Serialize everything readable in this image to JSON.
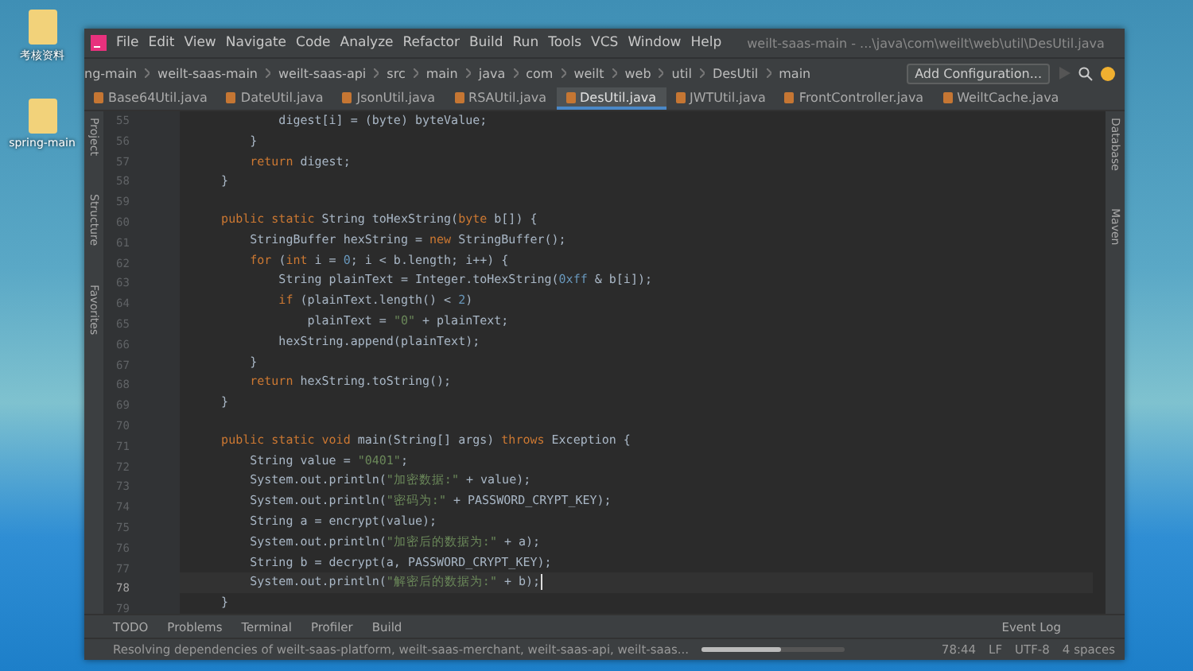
{
  "desktop_icons": [
    {
      "label": "考核资料"
    },
    {
      "label": "spring-main"
    }
  ],
  "window": {
    "title": "weilt-saas-main - ...\\java\\com\\weilt\\web\\util\\DesUtil.java"
  },
  "menu": [
    "File",
    "Edit",
    "View",
    "Navigate",
    "Code",
    "Analyze",
    "Refactor",
    "Build",
    "Run",
    "Tools",
    "VCS",
    "Window",
    "Help"
  ],
  "breadcrumbs": [
    "ng-main",
    "weilt-saas-main",
    "weilt-saas-api",
    "src",
    "main",
    "java",
    "com",
    "weilt",
    "web",
    "util",
    "DesUtil",
    "main"
  ],
  "run_config": "Add Configuration...",
  "tabs": [
    {
      "label": "Base64Util.java",
      "selected": false
    },
    {
      "label": "DateUtil.java",
      "selected": false
    },
    {
      "label": "JsonUtil.java",
      "selected": false
    },
    {
      "label": "RSAUtil.java",
      "selected": false
    },
    {
      "label": "DesUtil.java",
      "selected": true
    },
    {
      "label": "JWTUtil.java",
      "selected": false
    },
    {
      "label": "FrontController.java",
      "selected": false
    },
    {
      "label": "WeiltCache.java",
      "selected": false
    }
  ],
  "left_tools": [
    "Project",
    "Structure",
    "Favorites"
  ],
  "right_tools": [
    "Database",
    "Maven"
  ],
  "code": [
    {
      "number": "55",
      "current": false,
      "parts": [
        {
          "kind": "plain",
          "text": "            digest[i] = (byte) byteValue;"
        }
      ]
    },
    {
      "number": "56",
      "current": false,
      "parts": [
        {
          "kind": "plain",
          "text": "        }"
        }
      ]
    },
    {
      "number": "57",
      "current": false,
      "parts": [
        {
          "kind": "keyword",
          "text": "        return "
        },
        {
          "kind": "plain",
          "text": "digest;"
        }
      ]
    },
    {
      "number": "58",
      "current": false,
      "parts": [
        {
          "kind": "plain",
          "text": "    }"
        }
      ]
    },
    {
      "number": "59",
      "current": false
    },
    {
      "number": "60",
      "current": false,
      "parts": [
        {
          "kind": "keyword",
          "text": "    public static "
        },
        {
          "kind": "plain",
          "text": "String toHexString("
        },
        {
          "kind": "keyword",
          "text": "byte "
        },
        {
          "kind": "plain",
          "text": "b[]) {"
        }
      ]
    },
    {
      "number": "61",
      "current": false,
      "parts": [
        {
          "kind": "plain",
          "text": "        StringBuffer hexString = "
        },
        {
          "kind": "keyword",
          "text": "new "
        },
        {
          "kind": "plain",
          "text": "StringBuffer();"
        }
      ]
    },
    {
      "number": "62",
      "current": false,
      "parts": [
        {
          "kind": "keyword",
          "text": "        for "
        },
        {
          "kind": "plain",
          "text": "("
        },
        {
          "kind": "keyword",
          "text": "int "
        },
        {
          "kind": "plain",
          "text": "i = "
        },
        {
          "kind": "number",
          "text": "0"
        },
        {
          "kind": "plain",
          "text": "; i < b.length; i++) {"
        }
      ]
    },
    {
      "number": "63",
      "current": false,
      "parts": [
        {
          "kind": "plain",
          "text": "            String plainText = Integer.toHexString("
        },
        {
          "kind": "number",
          "text": "0xff"
        },
        {
          "kind": "plain",
          "text": " & b[i]);"
        }
      ]
    },
    {
      "number": "64",
      "current": false,
      "parts": [
        {
          "kind": "keyword",
          "text": "            if "
        },
        {
          "kind": "plain",
          "text": "(plainText.length() < "
        },
        {
          "kind": "number",
          "text": "2"
        },
        {
          "kind": "plain",
          "text": ")"
        }
      ]
    },
    {
      "number": "65",
      "current": false,
      "parts": [
        {
          "kind": "plain",
          "text": "                plainText = "
        },
        {
          "kind": "string",
          "text": "\"0\""
        },
        {
          "kind": "plain",
          "text": " + plainText;"
        }
      ]
    },
    {
      "number": "66",
      "current": false,
      "parts": [
        {
          "kind": "plain",
          "text": "            hexString.append(plainText);"
        }
      ]
    },
    {
      "number": "67",
      "current": false,
      "parts": [
        {
          "kind": "plain",
          "text": "        }"
        }
      ]
    },
    {
      "number": "68",
      "current": false,
      "parts": [
        {
          "kind": "keyword",
          "text": "        return "
        },
        {
          "kind": "plain",
          "text": "hexString.toString();"
        }
      ]
    },
    {
      "number": "69",
      "current": false,
      "parts": [
        {
          "kind": "plain",
          "text": "    }"
        }
      ]
    },
    {
      "number": "70",
      "current": false
    },
    {
      "number": "71",
      "current": false,
      "parts": [
        {
          "kind": "keyword",
          "text": "    public static void "
        },
        {
          "kind": "plain",
          "text": "main(String[] args) "
        },
        {
          "kind": "keyword",
          "text": "throws "
        },
        {
          "kind": "plain",
          "text": "Exception {"
        }
      ]
    },
    {
      "number": "72",
      "current": false,
      "parts": [
        {
          "kind": "plain",
          "text": "        String value = "
        },
        {
          "kind": "string",
          "text": "\"0401\""
        },
        {
          "kind": "plain",
          "text": ";"
        }
      ]
    },
    {
      "number": "73",
      "current": false,
      "parts": [
        {
          "kind": "plain",
          "text": "        System.out.println("
        },
        {
          "kind": "string",
          "text": "\"加密数据:\""
        },
        {
          "kind": "plain",
          "text": " + value);"
        }
      ]
    },
    {
      "number": "74",
      "current": false,
      "parts": [
        {
          "kind": "plain",
          "text": "        System.out.println("
        },
        {
          "kind": "string",
          "text": "\"密码为:\""
        },
        {
          "kind": "plain",
          "text": " + PASSWORD_CRYPT_KEY);"
        }
      ]
    },
    {
      "number": "75",
      "current": false,
      "parts": [
        {
          "kind": "plain",
          "text": "        String a = encrypt(value);"
        }
      ]
    },
    {
      "number": "76",
      "current": false,
      "parts": [
        {
          "kind": "plain",
          "text": "        System.out.println("
        },
        {
          "kind": "string",
          "text": "\"加密后的数据为:\""
        },
        {
          "kind": "plain",
          "text": " + a);"
        }
      ]
    },
    {
      "number": "77",
      "current": false,
      "parts": [
        {
          "kind": "plain",
          "text": "        String b = decrypt(a, PASSWORD_CRYPT_KEY);"
        }
      ]
    },
    {
      "number": "78",
      "current": true,
      "parts": [
        {
          "kind": "plain",
          "text": "        System.out.println("
        },
        {
          "kind": "string",
          "text": "\"解密后的数据为:\""
        },
        {
          "kind": "plain",
          "text": " + b);"
        }
      ]
    },
    {
      "number": "79",
      "current": false,
      "parts": [
        {
          "kind": "plain",
          "text": "    }"
        }
      ]
    }
  ],
  "bottom_tools": [
    "TODO",
    "Problems",
    "Terminal",
    "Profiler",
    "Build"
  ],
  "event_log": "Event Log",
  "status_bar": {
    "message": "Resolving dependencies of weilt-saas-platform, weilt-saas-merchant, weilt-saas-api, weilt-saas...",
    "level": 0.55,
    "position": "78:44",
    "line_ending": "LF",
    "encoding": "UTF-8",
    "indent": "4 spaces"
  }
}
